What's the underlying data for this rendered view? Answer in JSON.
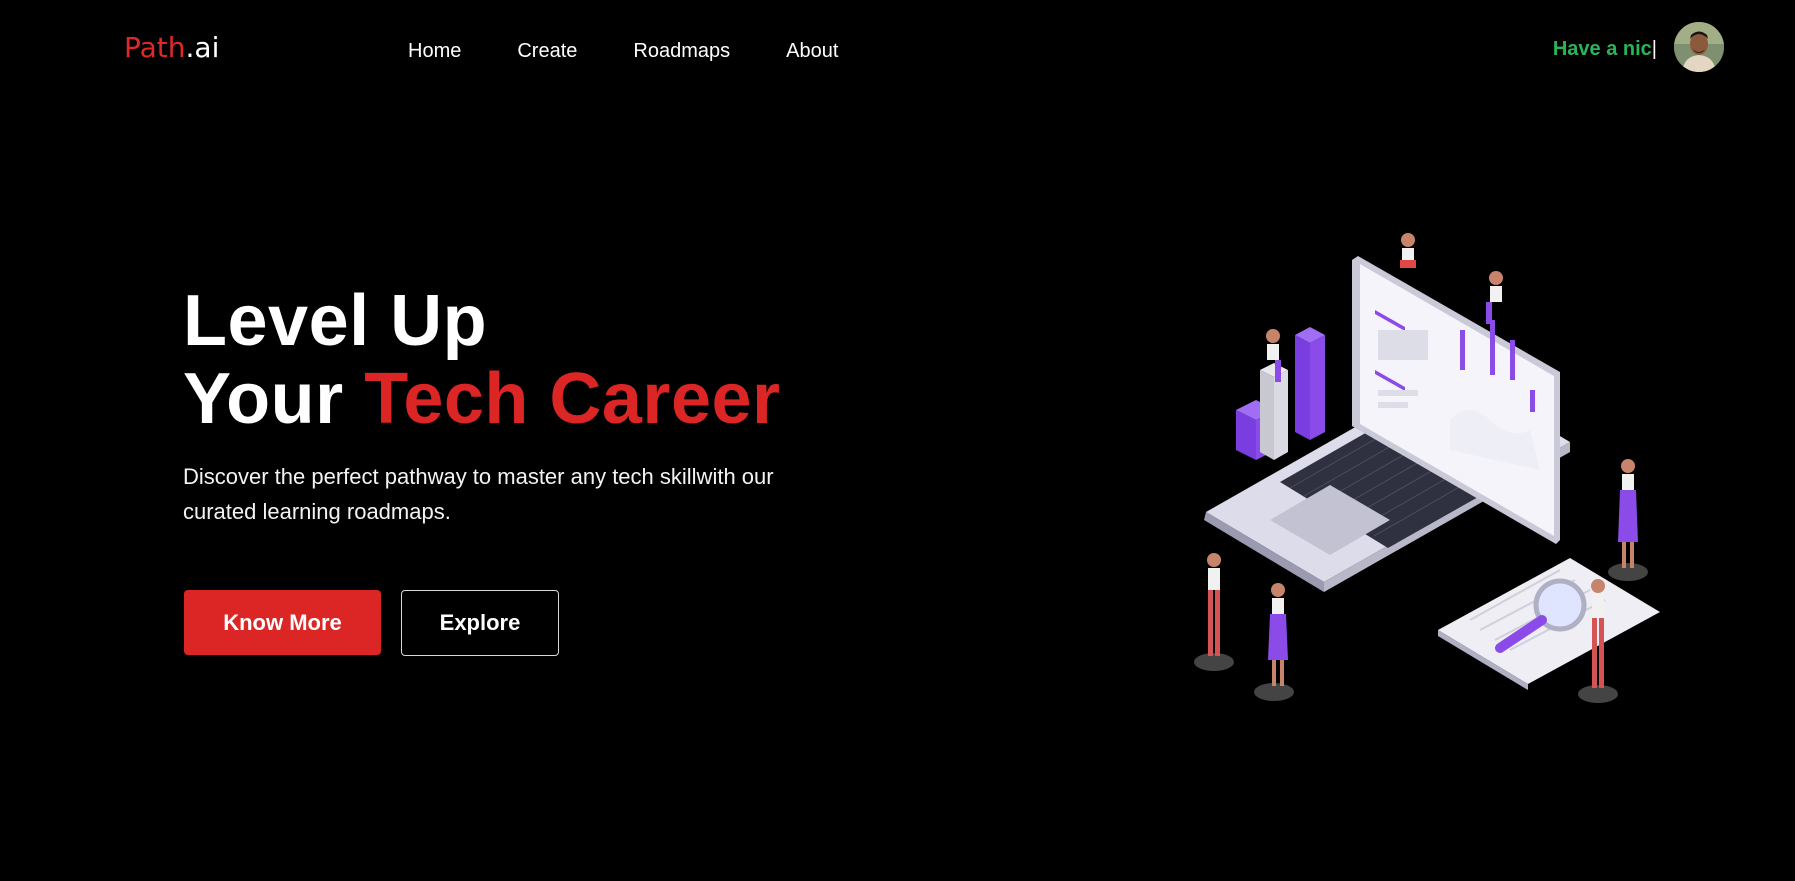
{
  "brand": {
    "name_part1": "Path",
    "name_part2": ".ai"
  },
  "nav": {
    "items": [
      {
        "label": "Home"
      },
      {
        "label": "Create"
      },
      {
        "label": "Roadmaps"
      },
      {
        "label": "About"
      }
    ]
  },
  "user": {
    "greeting": "Have a nic",
    "cursor": "|"
  },
  "hero": {
    "title_line1": "Level Up",
    "title_line2_white": "Your",
    "title_line2_red": "Tech Career",
    "description": "Discover the perfect pathway to master any tech skillwith our curated learning roadmaps.",
    "primary_button": "Know More",
    "secondary_button": "Explore"
  },
  "colors": {
    "background": "#000000",
    "accent_red": "#dc2626",
    "greeting_green": "#2bb35a",
    "illustration_purple": "#8b4be8"
  },
  "icons": {
    "avatar": "user-avatar-photo",
    "illustration": "isometric-laptop-team-illustration"
  }
}
